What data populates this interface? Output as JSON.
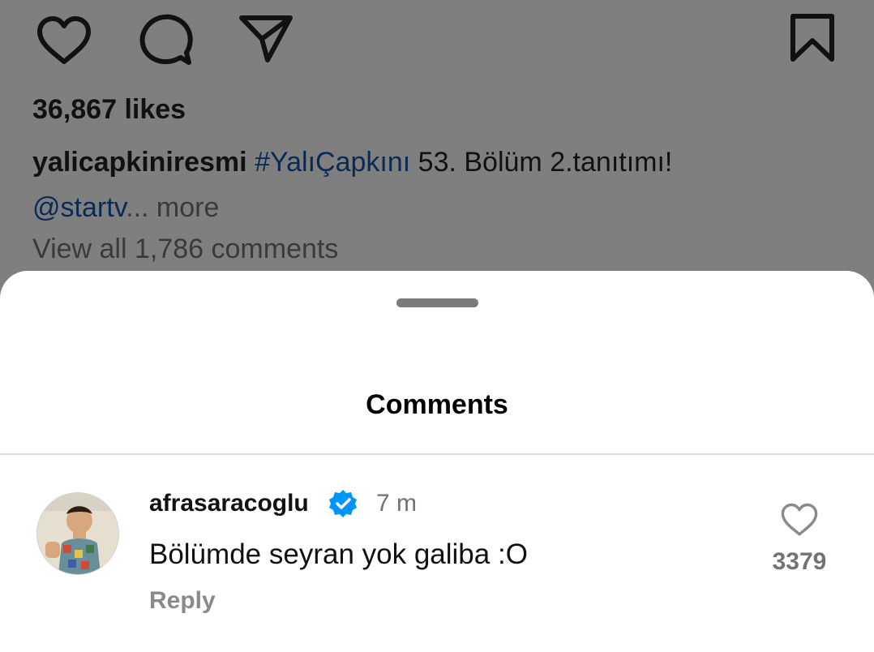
{
  "post": {
    "likes": "36,867 likes",
    "username": "yalicapkiniresmi",
    "hashtag": "#YalıÇapkını",
    "caption_text": " 53. Bölüm 2.tanıtımı!",
    "mention": "@startv",
    "ellipsis": "...",
    "more": " more",
    "view_all_comments": "View all 1,786 comments",
    "icons": [
      "heart-icon",
      "comment-icon",
      "share-icon",
      "bookmark-icon"
    ]
  },
  "sheet": {
    "title": "Comments"
  },
  "comments": [
    {
      "username": "afrasaracoglu",
      "verified": true,
      "time": "7 m",
      "text": "Bölümde seyran yok galiba :O",
      "reply_label": "Reply",
      "like_count": "3379"
    }
  ],
  "colors": {
    "overlay": "#7f7f7f",
    "verified_blue": "#0095f6",
    "hashtag": "#0a2a54"
  }
}
